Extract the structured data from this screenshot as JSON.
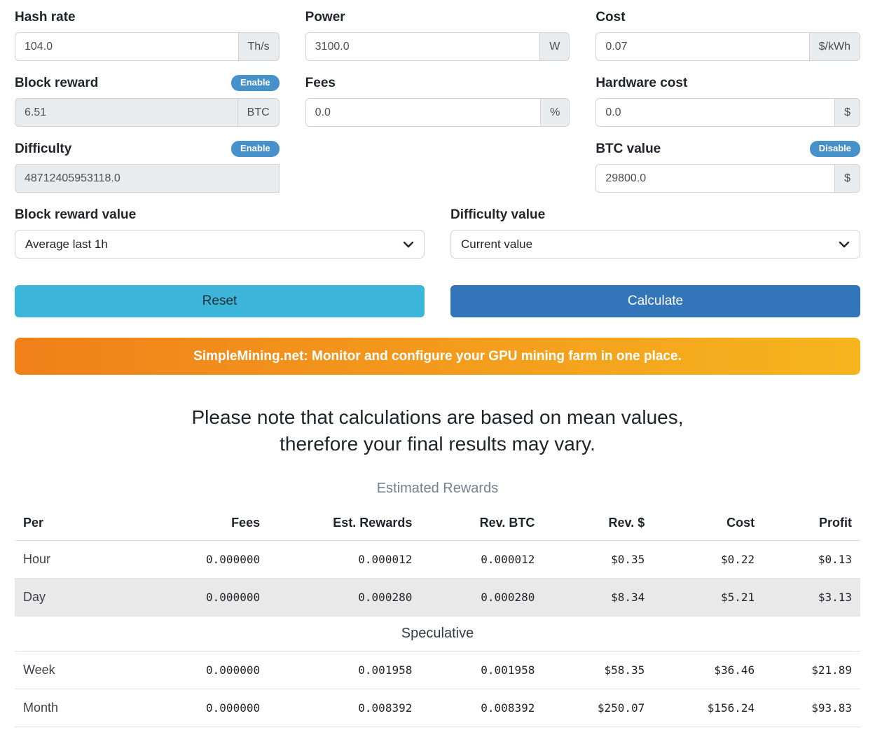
{
  "theme": {
    "badge_blue": "#4791ca",
    "reset_bg": "#3db5d8",
    "reset_text": "#1d3038",
    "calculate_bg": "#3375b9",
    "banner_from": "#f0801a",
    "banner_to": "#f6b51f"
  },
  "form": {
    "hash_rate": {
      "label": "Hash rate",
      "value": "104.0",
      "unit": "Th/s"
    },
    "power": {
      "label": "Power",
      "value": "3100.0",
      "unit": "W"
    },
    "cost": {
      "label": "Cost",
      "value": "0.07",
      "unit": "$/kWh"
    },
    "block_reward": {
      "label": "Block reward",
      "value": "6.51",
      "unit": "BTC",
      "badge": "Enable"
    },
    "fees": {
      "label": "Fees",
      "value": "0.0",
      "unit": "%"
    },
    "hardware_cost": {
      "label": "Hardware cost",
      "value": "0.0",
      "unit": "$"
    },
    "difficulty": {
      "label": "Difficulty",
      "value": "48712405953118.0",
      "badge": "Enable"
    },
    "btc_value": {
      "label": "BTC value",
      "value": "29800.0",
      "unit": "$",
      "badge": "Disable"
    }
  },
  "selects": {
    "block_reward_value": {
      "label": "Block reward value",
      "selected": "Average last 1h"
    },
    "difficulty_value": {
      "label": "Difficulty value",
      "selected": "Current value"
    }
  },
  "buttons": {
    "reset": "Reset",
    "calculate": "Calculate"
  },
  "banner": {
    "text": "SimpleMining.net: Monitor and configure your GPU mining farm in one place."
  },
  "note": {
    "line1": "Please note that calculations are based on mean values,",
    "line2": "therefore your final results may vary."
  },
  "rewards_table": {
    "heading": "Estimated Rewards",
    "columns": [
      "Per",
      "Fees",
      "Est. Rewards",
      "Rev. BTC",
      "Rev. $",
      "Cost",
      "Profit"
    ],
    "rows": [
      {
        "label": "Hour",
        "values": [
          "0.000000",
          "0.000012",
          "0.000012",
          "$0.35",
          "$0.22",
          "$0.13"
        ]
      },
      {
        "label": "Day",
        "values": [
          "0.000000",
          "0.000280",
          "0.000280",
          "$8.34",
          "$5.21",
          "$3.13"
        ]
      }
    ],
    "section": "Speculative",
    "spec_rows": [
      {
        "label": "Week",
        "values": [
          "0.000000",
          "0.001958",
          "0.001958",
          "$58.35",
          "$36.46",
          "$21.89"
        ]
      },
      {
        "label": "Month",
        "values": [
          "0.000000",
          "0.008392",
          "0.008392",
          "$250.07",
          "$156.24",
          "$93.83"
        ]
      }
    ]
  }
}
